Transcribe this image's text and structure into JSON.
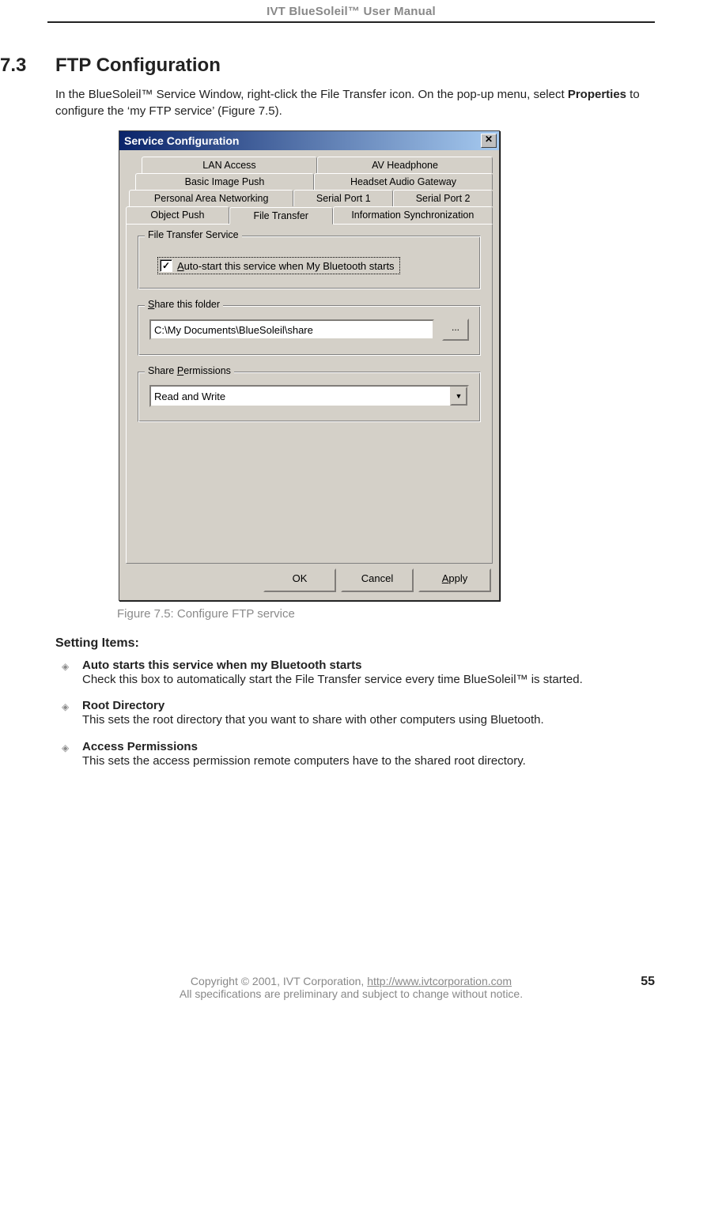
{
  "header": {
    "title": "IVT BlueSoleil™ User Manual"
  },
  "section": {
    "num": "7.3",
    "title": "FTP Configuration",
    "intro_1": "In the BlueSoleil™ Service Window, right-click the File Transfer icon. On the pop-up menu, select ",
    "intro_bold": "Properties",
    "intro_2": " to configure the ‘my FTP service’ (Figure 7.5)."
  },
  "dialog": {
    "title": "Service Configuration",
    "close": "✕",
    "tabs": {
      "r1": [
        "LAN Access",
        "AV Headphone"
      ],
      "r2": [
        "Basic Image Push",
        "Headset Audio Gateway"
      ],
      "r3": [
        "Personal Area Networking",
        "Serial Port 1",
        "Serial Port 2"
      ],
      "r4": [
        "Object Push",
        "File Transfer",
        "Information Synchronization"
      ]
    },
    "group_main": "File Transfer Service",
    "checkbox": {
      "checked": "✓",
      "label_pre": "A",
      "label_post": "uto-start this service when My Bluetooth starts"
    },
    "group_share": {
      "legend_pre": "S",
      "legend_post": "hare this folder",
      "value": "C:\\My Documents\\BlueSoleil\\share",
      "browse": "..."
    },
    "group_perm": {
      "legend_pre": "Share ",
      "legend_u": "P",
      "legend_post": "ermissions",
      "value": "Read and Write",
      "arrow": "▼"
    },
    "buttons": {
      "ok": "OK",
      "cancel": "Cancel",
      "apply_u": "A",
      "apply_post": "pply"
    }
  },
  "caption": "Figure 7.5: Configure FTP service",
  "settings": {
    "heading": "Setting Items:",
    "items": [
      {
        "title": "Auto starts this service when my Bluetooth starts",
        "body": "Check this box to automatically start the File Transfer service every time BlueSoleil™ is started."
      },
      {
        "title": "Root Directory",
        "body": "This sets the root directory that you want to share with other computers using Bluetooth."
      },
      {
        "title": "Access Permissions",
        "body": "This sets the access permission remote computers have to the shared root directory."
      }
    ]
  },
  "footer": {
    "line1a": "Copyright © 2001, IVT Corporation, ",
    "line1_link": "http://www.ivtcorporation.com",
    "line2": "All specifications are preliminary and subject to change without notice.",
    "page": "55"
  }
}
